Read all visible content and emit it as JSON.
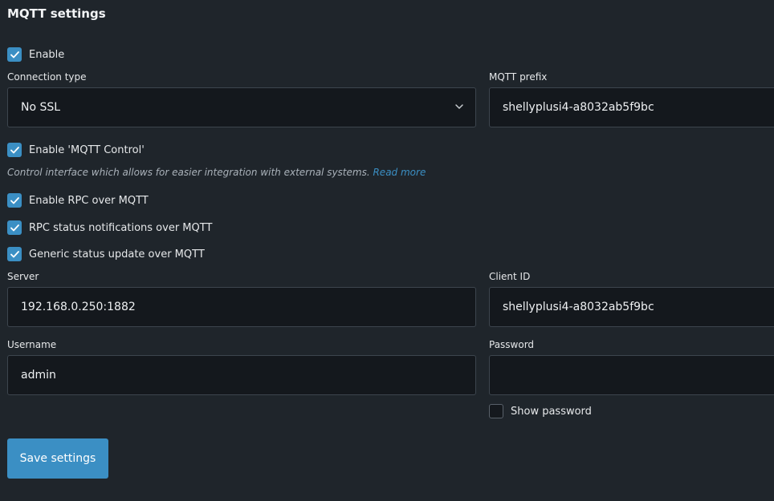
{
  "section": {
    "title": "MQTT settings"
  },
  "enable": {
    "label": "Enable",
    "checked": true
  },
  "connection_type": {
    "label": "Connection type",
    "value": "No SSL"
  },
  "mqtt_prefix": {
    "label": "MQTT prefix",
    "value": "shellyplusi4-a8032ab5f9bc"
  },
  "mqtt_control": {
    "label": "Enable 'MQTT Control'",
    "checked": true,
    "help_text": "Control interface which allows for easier integration with external systems.",
    "read_more": "Read more"
  },
  "rpc_over_mqtt": {
    "label": "Enable RPC over MQTT",
    "checked": true
  },
  "rpc_status": {
    "label": "RPC status notifications over MQTT",
    "checked": true
  },
  "generic_status": {
    "label": "Generic status update over MQTT",
    "checked": true
  },
  "server": {
    "label": "Server",
    "value": "192.168.0.250:1882"
  },
  "client_id": {
    "label": "Client ID",
    "value": "shellyplusi4-a8032ab5f9bc"
  },
  "username": {
    "label": "Username",
    "value": "admin"
  },
  "password": {
    "label": "Password",
    "value": ""
  },
  "show_password": {
    "label": "Show password",
    "checked": false
  },
  "actions": {
    "save_label": "Save settings"
  },
  "colors": {
    "background": "#1f252b",
    "input_background": "#14181d",
    "accent": "#3b8fc4",
    "text": "#e6e8ea"
  }
}
